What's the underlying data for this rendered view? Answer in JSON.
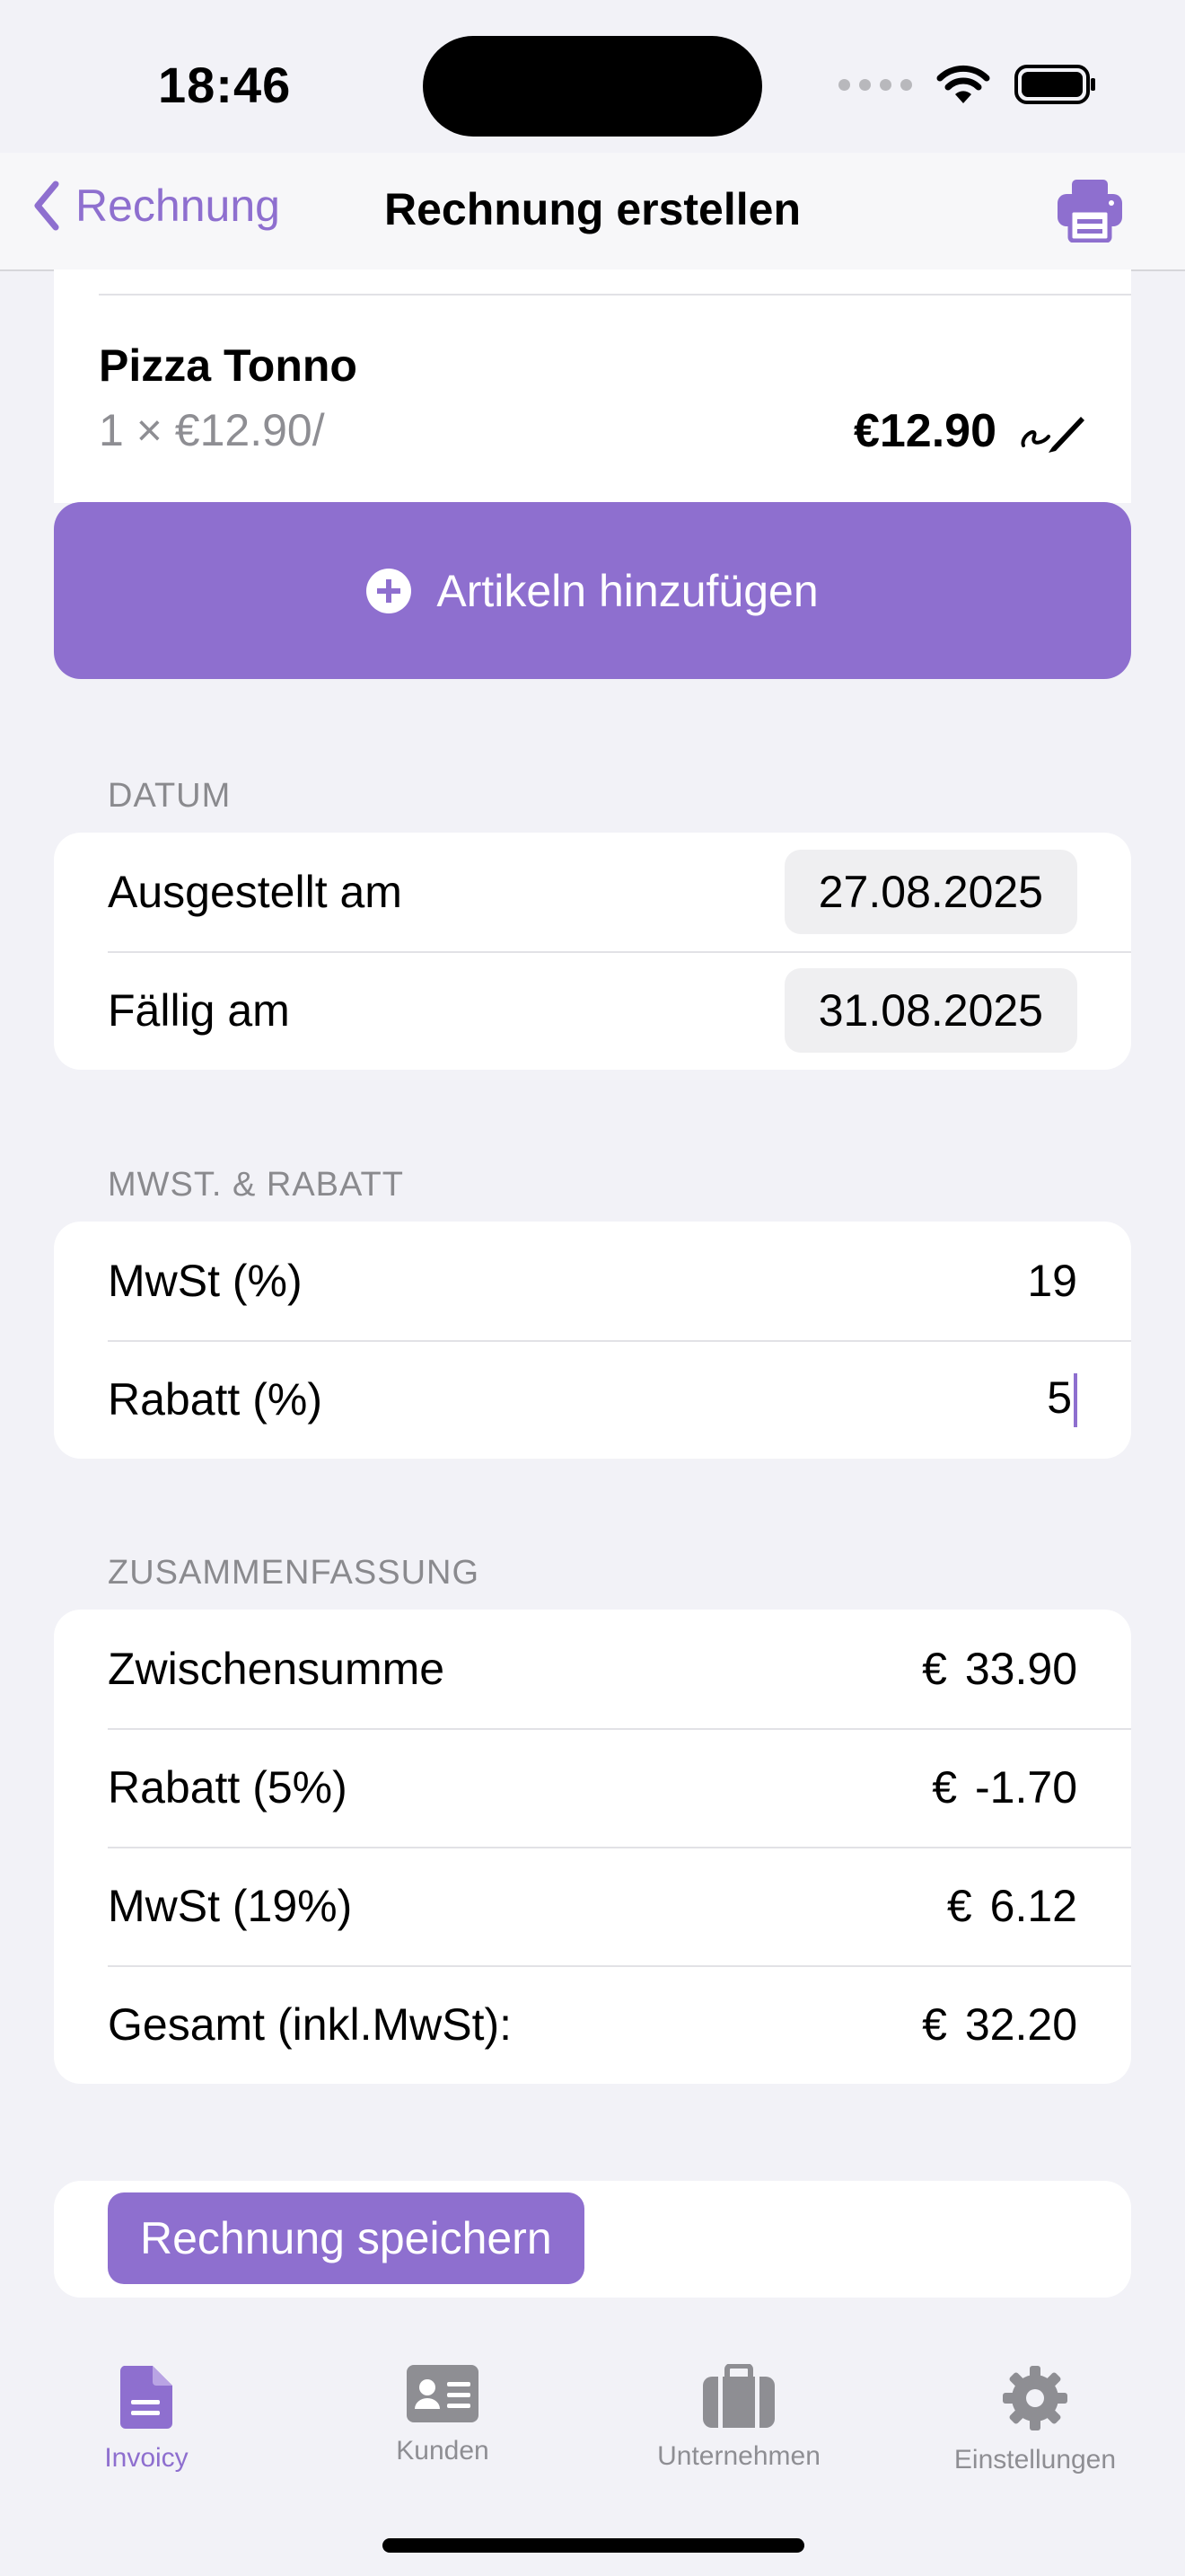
{
  "status_bar": {
    "time": "18:46"
  },
  "nav": {
    "back_label": "Rechnung",
    "title": "Rechnung erstellen",
    "print_icon": "printer-icon"
  },
  "item": {
    "name": "Pizza Tonno",
    "qty_price": "1 × €12.90/",
    "total": "€12.90",
    "edit_icon": "pencil-icon"
  },
  "add_button": {
    "label": "Artikeln hinzufügen",
    "icon": "plus-circle-icon"
  },
  "date_section": {
    "header": "DATUM",
    "issued_label": "Ausgestellt am",
    "issued_value": "27.08.2025",
    "due_label": "Fällig am",
    "due_value": "31.08.2025"
  },
  "tax_section": {
    "header": "MWST. & RABATT",
    "vat_label": "MwSt (%)",
    "vat_value": "19",
    "discount_label": "Rabatt (%)",
    "discount_value": "5"
  },
  "summary": {
    "header": "ZUSAMMENFASSUNG",
    "currency": "€",
    "subtotal_label": "Zwischensumme",
    "subtotal_value": "33.90",
    "discount_label": "Rabatt (5%)",
    "discount_value": "-1.70",
    "vat_label": "MwSt (19%)",
    "vat_value": "6.12",
    "total_label": "Gesamt (inkl.MwSt):",
    "total_value": "32.20"
  },
  "save_button": {
    "label": "Rechnung speichern"
  },
  "tabs": [
    {
      "label": "Invoicy",
      "icon": "document-icon",
      "active": true
    },
    {
      "label": "Kunden",
      "icon": "contact-card-icon",
      "active": false
    },
    {
      "label": "Unternehmen",
      "icon": "briefcase-icon",
      "active": false
    },
    {
      "label": "Einstellungen",
      "icon": "gear-icon",
      "active": false
    }
  ],
  "colors": {
    "accent": "#8E6FCF",
    "background": "#F2F2F7",
    "secondary_text": "#8E8E93"
  }
}
